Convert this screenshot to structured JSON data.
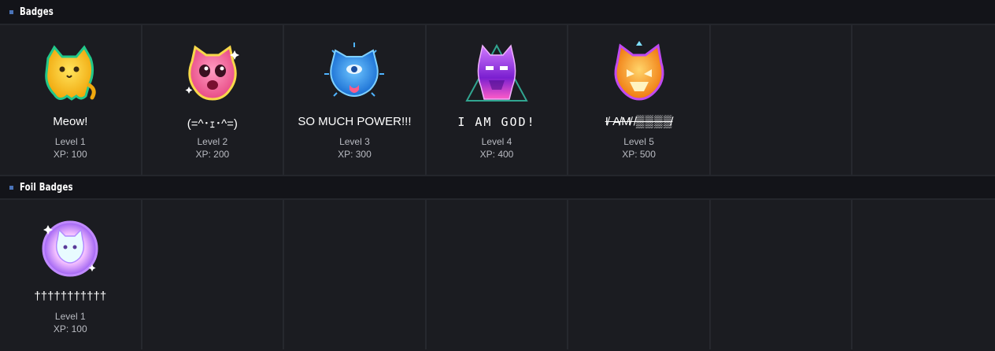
{
  "sections": {
    "badges": {
      "title": "Badges",
      "items": [
        {
          "name": "Meow!",
          "level": "Level 1",
          "xp": "XP: 100",
          "icon": "yellow-cat-badge-icon",
          "color": "#f7c624"
        },
        {
          "name": "(=^･ｪ･^=)",
          "level": "Level 2",
          "xp": "XP: 200",
          "icon": "pink-cat-badge-icon",
          "color": "#f36aa0"
        },
        {
          "name": "SO MUCH POWER!!!",
          "level": "Level 3",
          "xp": "XP: 300",
          "icon": "blue-cat-badge-icon",
          "color": "#2f8fe8"
        },
        {
          "name": "I AM GOD!",
          "level": "Level 4",
          "xp": "XP: 400",
          "icon": "purple-cat-badge-icon",
          "color": "#a53be0"
        },
        {
          "name": "I̸ A̸M̸ ̸▒▒▒▒̸",
          "level": "Level 5",
          "xp": "XP: 500",
          "icon": "gold-cat-badge-icon",
          "color": "#f5a623"
        }
      ]
    },
    "foil_badges": {
      "title": "Foil Badges",
      "items": [
        {
          "name": "†††††††††††",
          "level": "Level 1",
          "xp": "XP: 100",
          "icon": "foil-cat-badge-icon",
          "color": "#c9a8ff"
        }
      ]
    }
  }
}
